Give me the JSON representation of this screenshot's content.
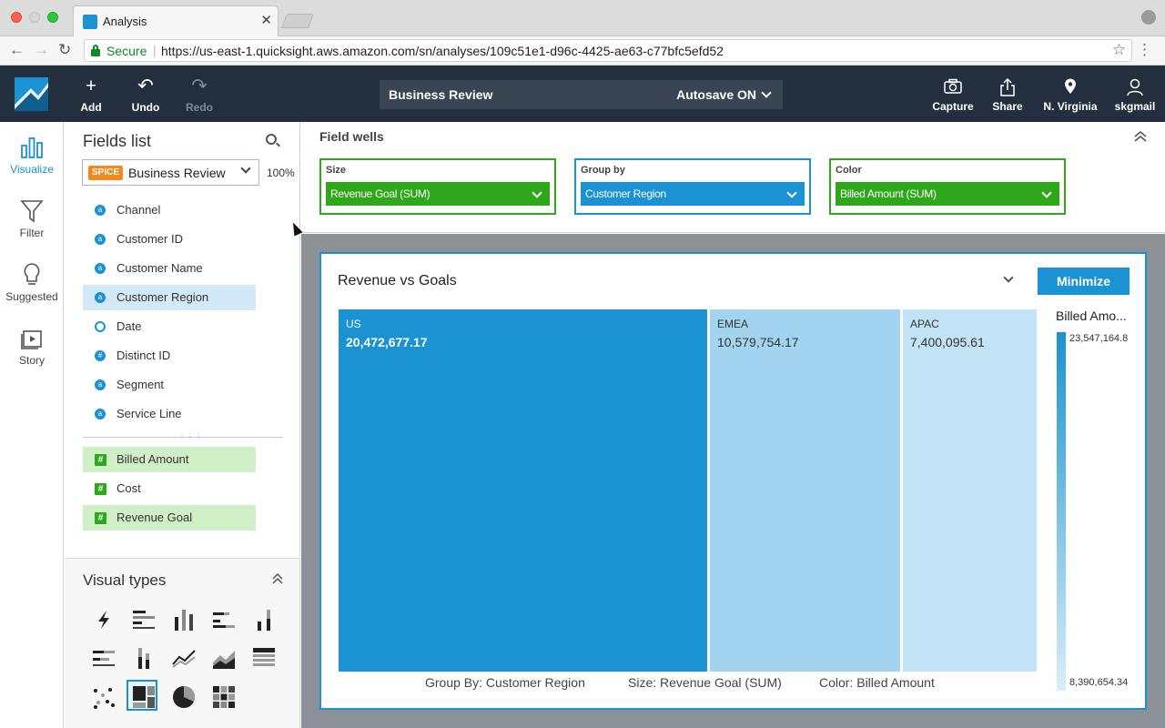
{
  "browser": {
    "tab_title": "Analysis",
    "secure_label": "Secure",
    "url": "https://us-east-1.quicksight.aws.amazon.com/sn/analyses/109c51e1-d96c-4425-ae63-c77bfc5efd52"
  },
  "header": {
    "add_label": "Add",
    "undo_label": "Undo",
    "redo_label": "Redo",
    "analysis_name": "Business Review",
    "autosave_label": "Autosave ON",
    "capture_label": "Capture",
    "share_label": "Share",
    "region_label": "N. Virginia",
    "user_label": "skgmail"
  },
  "rail": {
    "visualize": "Visualize",
    "filter": "Filter",
    "suggested": "Suggested",
    "story": "Story"
  },
  "fields": {
    "title": "Fields list",
    "spice_badge": "SPICE",
    "dataset": "Business Review",
    "spice_pct": "100%",
    "dimensions": [
      {
        "label": "Channel",
        "type": "string"
      },
      {
        "label": "Customer ID",
        "type": "string"
      },
      {
        "label": "Customer Name",
        "type": "string"
      },
      {
        "label": "Customer Region",
        "type": "string",
        "selected": true
      },
      {
        "label": "Date",
        "type": "date"
      },
      {
        "label": "Distinct ID",
        "type": "number"
      },
      {
        "label": "Segment",
        "type": "string"
      },
      {
        "label": "Service Line",
        "type": "string"
      }
    ],
    "measures": [
      {
        "label": "Billed Amount",
        "selected": true
      },
      {
        "label": "Cost",
        "selected": false
      },
      {
        "label": "Revenue Goal",
        "selected": true
      }
    ]
  },
  "visual_types": {
    "title": "Visual types"
  },
  "field_wells": {
    "title": "Field wells",
    "wells": [
      {
        "label": "Size",
        "value": "Revenue Goal (SUM)",
        "color": "#2ea81a"
      },
      {
        "label": "Group by",
        "value": "Customer Region",
        "color": "#1b92d1"
      },
      {
        "label": "Color",
        "value": "Billed Amount (SUM)",
        "color": "#2ea81a"
      }
    ]
  },
  "visual": {
    "title": "Revenue vs Goals",
    "minimize_label": "Minimize",
    "footer_group": "Group By: Customer Region",
    "footer_size": "Size: Revenue Goal (SUM)",
    "footer_color": "Color: Billed Amount",
    "legend_title": "Billed Amo...",
    "legend_max": "23,547,164.8",
    "legend_min": "8,390,654.34"
  },
  "chart_data": {
    "type": "treemap",
    "group_by": "Customer Region",
    "size_field": "Revenue Goal (SUM)",
    "color_field": "Billed Amount (SUM)",
    "color_range": [
      "#d8eefa",
      "#1b92d1"
    ],
    "items": [
      {
        "label": "US",
        "value_text": "20,472,677.17",
        "size": 20472677.17,
        "color_level": 1.0
      },
      {
        "label": "EMEA",
        "value_text": "10,579,754.17",
        "size": 10579754.17,
        "color_level": 0.28
      },
      {
        "label": "APAC",
        "value_text": "7,400,095.61",
        "size": 7400095.61,
        "color_level": 0.12
      }
    ]
  }
}
